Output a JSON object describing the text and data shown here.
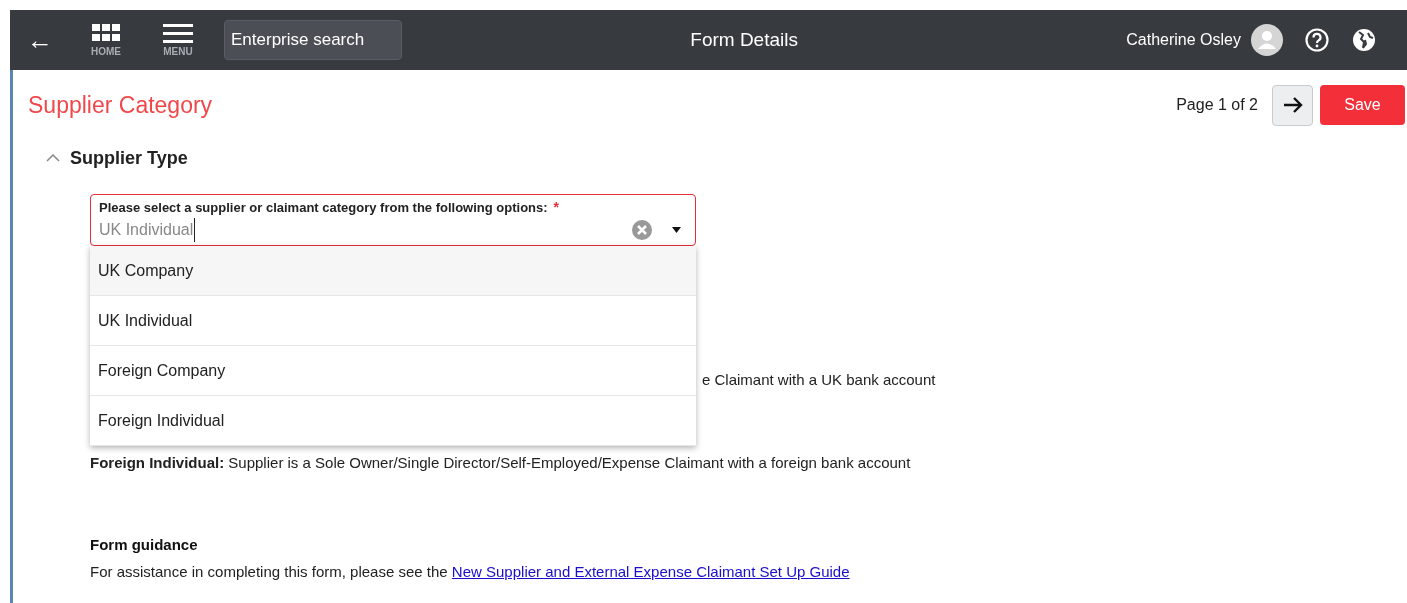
{
  "header": {
    "back": "←",
    "nav": [
      {
        "label": "HOME",
        "kind": "grid"
      },
      {
        "label": "MENU",
        "kind": "menu"
      }
    ],
    "search": {
      "placeholder": "Enterprise search"
    },
    "title": "Form Details",
    "user": "Catherine Osley"
  },
  "page": {
    "title": "Supplier Category",
    "pager": "Page 1 of 2",
    "save": "Save"
  },
  "section": {
    "title": "Supplier Type",
    "expanded": true,
    "field": {
      "label": "Please select a supplier or claimant category from the following options:",
      "required": "*",
      "value": "UK Individual",
      "open": true,
      "options": [
        {
          "label": "UK Company",
          "highlighted": true
        },
        {
          "label": "UK Individual",
          "highlighted": false
        },
        {
          "label": "Foreign Company",
          "highlighted": false
        },
        {
          "label": "Foreign Individual",
          "highlighted": false
        }
      ]
    },
    "descriptions": [
      {
        "text": "e Claimant with a UK bank account",
        "kind": "partial"
      },
      {
        "text": "**Foreign Individual:** Supplier is a Sole Owner/Single Director/Self-Employed/Expense Claimant with a foreign bank account",
        "kind": "full"
      }
    ],
    "guidance": {
      "title": "Form guidance",
      "text": "For assistance in completing this form, please see the",
      "link": "New Supplier and External Expense Claimant Set Up Guide"
    }
  }
}
